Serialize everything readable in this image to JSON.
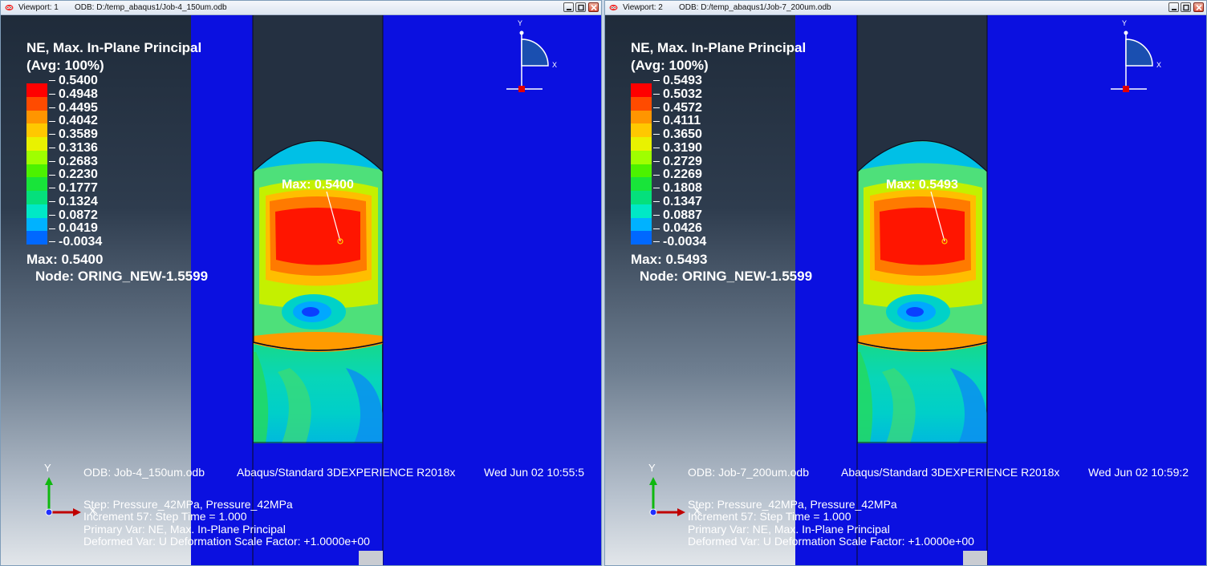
{
  "colors": {
    "model_blue": "#0b10e0",
    "legend": [
      "#ff0000",
      "#ff4b00",
      "#ff9500",
      "#ffc800",
      "#e9f200",
      "#9fff00",
      "#4cf200",
      "#18e43a",
      "#05e07c",
      "#00e8c6",
      "#00b2ff",
      "#0068ff",
      "#0a10ff"
    ]
  },
  "viewports": [
    {
      "name": "Viewport: 1",
      "odb_title": "ODB: D:/temp_abaqus1/Job-4_150um.odb",
      "legend_title_1": "NE, Max. In-Plane Principal",
      "legend_title_2": "(Avg: 100%)",
      "legend_values": [
        "0.5400",
        "0.4948",
        "0.4495",
        "0.4042",
        "0.3589",
        "0.3136",
        "0.2683",
        "0.2230",
        "0.1777",
        "0.1324",
        "0.0872",
        "0.0419",
        "-0.0034"
      ],
      "max_line": "Max: 0.5400",
      "node_line": "Node: ORING_NEW-1.5599",
      "max_marker_label": "Max: 0.5400",
      "odb_footer": "ODB: Job-4_150um.odb",
      "product": "Abaqus/Standard 3DEXPERIENCE R2018x",
      "date": "Wed Jun 02 10:55:5",
      "step_line": "Step: Pressure_42MPa, Pressure_42MPa",
      "increment_line": "Increment     57: Step Time =    1.000",
      "primary_var": "Primary Var: NE, Max. In-Plane Principal",
      "deformed_var": "Deformed Var: U   Deformation Scale Factor: +1.0000e+00",
      "triad": {
        "y": "Y",
        "x": "X",
        "z": "Z"
      },
      "view_triad": {
        "y": "Y",
        "x": "X"
      }
    },
    {
      "name": "Viewport: 2",
      "odb_title": "ODB: D:/temp_abaqus1/Job-7_200um.odb",
      "legend_title_1": "NE, Max. In-Plane Principal",
      "legend_title_2": "(Avg: 100%)",
      "legend_values": [
        "0.5493",
        "0.5032",
        "0.4572",
        "0.4111",
        "0.3650",
        "0.3190",
        "0.2729",
        "0.2269",
        "0.1808",
        "0.1347",
        "0.0887",
        "0.0426",
        "-0.0034"
      ],
      "max_line": "Max: 0.5493",
      "node_line": "Node: ORING_NEW-1.5599",
      "max_marker_label": "Max: 0.5493",
      "odb_footer": "ODB: Job-7_200um.odb",
      "product": "Abaqus/Standard 3DEXPERIENCE R2018x",
      "date": "Wed Jun 02 10:59:2",
      "step_line": "Step: Pressure_42MPa, Pressure_42MPa",
      "increment_line": "Increment     57: Step Time =    1.000",
      "primary_var": "Primary Var: NE, Max. In-Plane Principal",
      "deformed_var": "Deformed Var: U   Deformation Scale Factor: +1.0000e+00",
      "triad": {
        "y": "Y",
        "x": "X",
        "z": "Z"
      },
      "view_triad": {
        "y": "Y",
        "x": "X"
      }
    }
  ]
}
